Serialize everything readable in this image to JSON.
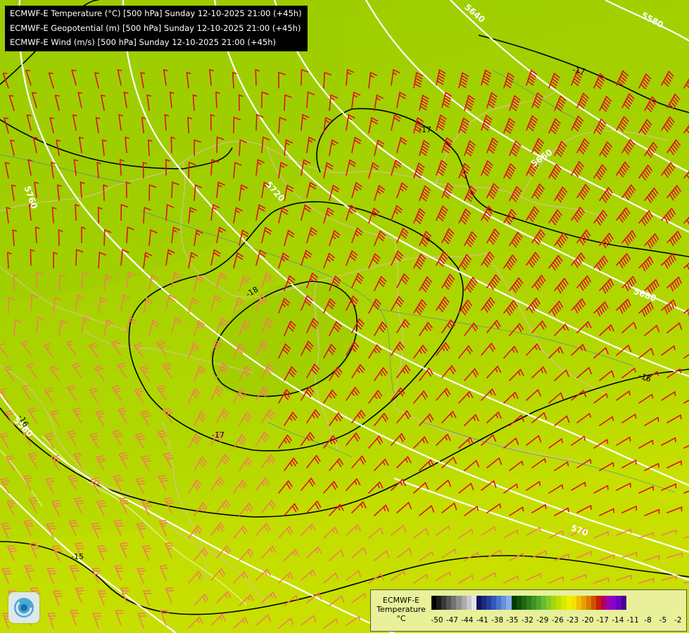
{
  "header": {
    "line1": "ECMWF-E Temperature (°C) [500 hPa] Sunday 12-10-2025 21:00 (+45h)",
    "line2": "ECMWF-E Geopotential (m) [500 hPa] Sunday 12-10-2025 21:00 (+45h)",
    "line3": "ECMWF-E Wind (m/s) [500 hPa] Sunday 12-10-2025 21:00 (+45h)"
  },
  "isohypse_labels": [
    "5580",
    "5640",
    "5660",
    "5680",
    "5720",
    "5760",
    "5580",
    "570"
  ],
  "isotherm_labels": [
    "-17",
    "-17",
    "-18",
    "-16",
    "-16",
    "-17",
    "-15"
  ],
  "legend": {
    "title_line1": "ECMWF-E",
    "title_line2": "Temperature",
    "unit": "°C",
    "ticks": [
      "-50",
      "-47",
      "-44",
      "-41",
      "-38",
      "-35",
      "-32",
      "-29",
      "-26",
      "-23",
      "-20",
      "-17",
      "-14",
      "-11",
      "-8",
      "-5",
      "-2"
    ],
    "colors": [
      "#000000",
      "#1c1c1c",
      "#383838",
      "#555555",
      "#727272",
      "#8e8e8e",
      "#ababab",
      "#c8c8c8",
      "#e4e4e4",
      "#101060",
      "#1a2a80",
      "#243ea0",
      "#3258b8",
      "#4a74cc",
      "#6690dc",
      "#86acea",
      "#003c00",
      "#0e5208",
      "#1e6812",
      "#2e7e1c",
      "#3e9426",
      "#50a830",
      "#68bc30",
      "#84cc20",
      "#a0d810",
      "#bce000",
      "#d8e800",
      "#eef000",
      "#f8e000",
      "#f0c000",
      "#e8a000",
      "#dc7c00",
      "#d05000",
      "#c42000",
      "#b00060",
      "#a000b0",
      "#8a00d0",
      "#6c00c0",
      "#4a0090"
    ],
    "colors_display": "gradient"
  },
  "colors": {
    "isohypse": "#ffffff",
    "isotherm": "#000000",
    "barb_strong": "#e01020",
    "barb_weak": "#f08050",
    "border": "#d8c49a",
    "river": "#3a78b8"
  }
}
